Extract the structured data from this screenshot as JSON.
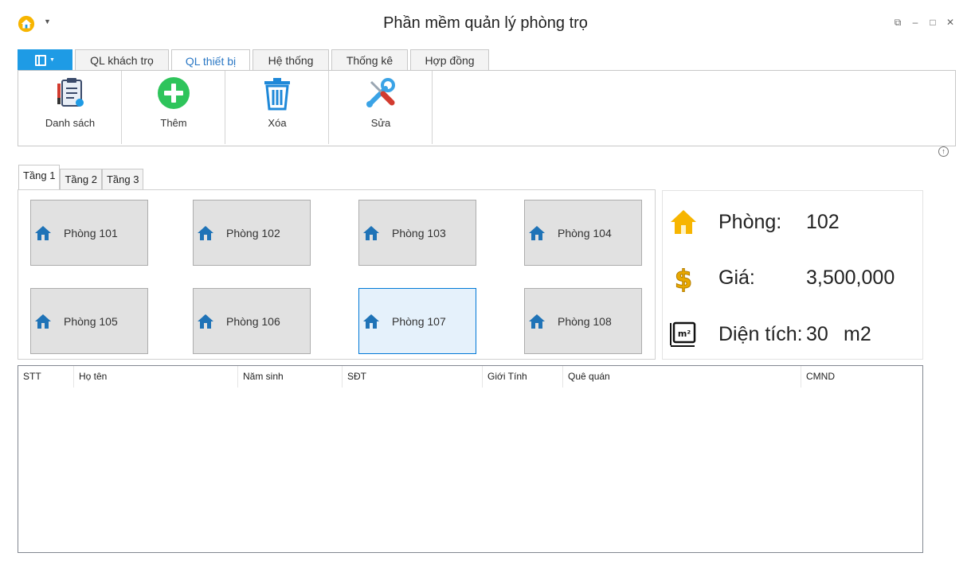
{
  "window": {
    "title": "Phần mềm quản lý phòng trọ",
    "buttons": [
      "restore-icon",
      "minimize-icon",
      "maximize-icon",
      "close-icon"
    ]
  },
  "ribbon": {
    "tabs": [
      {
        "label": "QL khách trọ",
        "active": false
      },
      {
        "label": "QL thiết bị",
        "active": true
      },
      {
        "label": "Hệ thống",
        "active": false
      },
      {
        "label": "Thống kê",
        "active": false
      },
      {
        "label": "Hợp đồng",
        "active": false
      }
    ],
    "buttons": [
      {
        "label": "Danh sách",
        "icon": "clipboard-tools-icon"
      },
      {
        "label": "Thêm",
        "icon": "plus-circle-icon"
      },
      {
        "label": "Xóa",
        "icon": "trash-icon"
      },
      {
        "label": "Sửa",
        "icon": "wrench-screwdriver-icon"
      }
    ],
    "accent": "#1e9be5"
  },
  "floors": {
    "tabs": [
      "Tầng 1",
      "Tầng 2",
      "Tầng 3"
    ],
    "active": "Tầng 1"
  },
  "rooms": [
    {
      "label": "Phòng 101",
      "selected": false
    },
    {
      "label": "Phòng 102",
      "selected": false
    },
    {
      "label": "Phòng 103",
      "selected": false
    },
    {
      "label": "Phòng 104",
      "selected": false
    },
    {
      "label": "Phòng 105",
      "selected": false
    },
    {
      "label": "Phòng 106",
      "selected": false
    },
    {
      "label": "Phòng 107",
      "selected": true
    },
    {
      "label": "Phòng 108",
      "selected": false
    }
  ],
  "room_info": {
    "room_label": "Phòng:",
    "room_value": "102",
    "price_label": "Giá:",
    "price_value": "3,500,000",
    "area_label": "Diện tích:",
    "area_value": "30",
    "area_unit": "m2"
  },
  "grid": {
    "columns": [
      "STT",
      "Họ tên",
      "Năm sinh",
      "SĐT",
      "Giới Tính",
      "Quê quán",
      "CMND"
    ],
    "rows": []
  }
}
